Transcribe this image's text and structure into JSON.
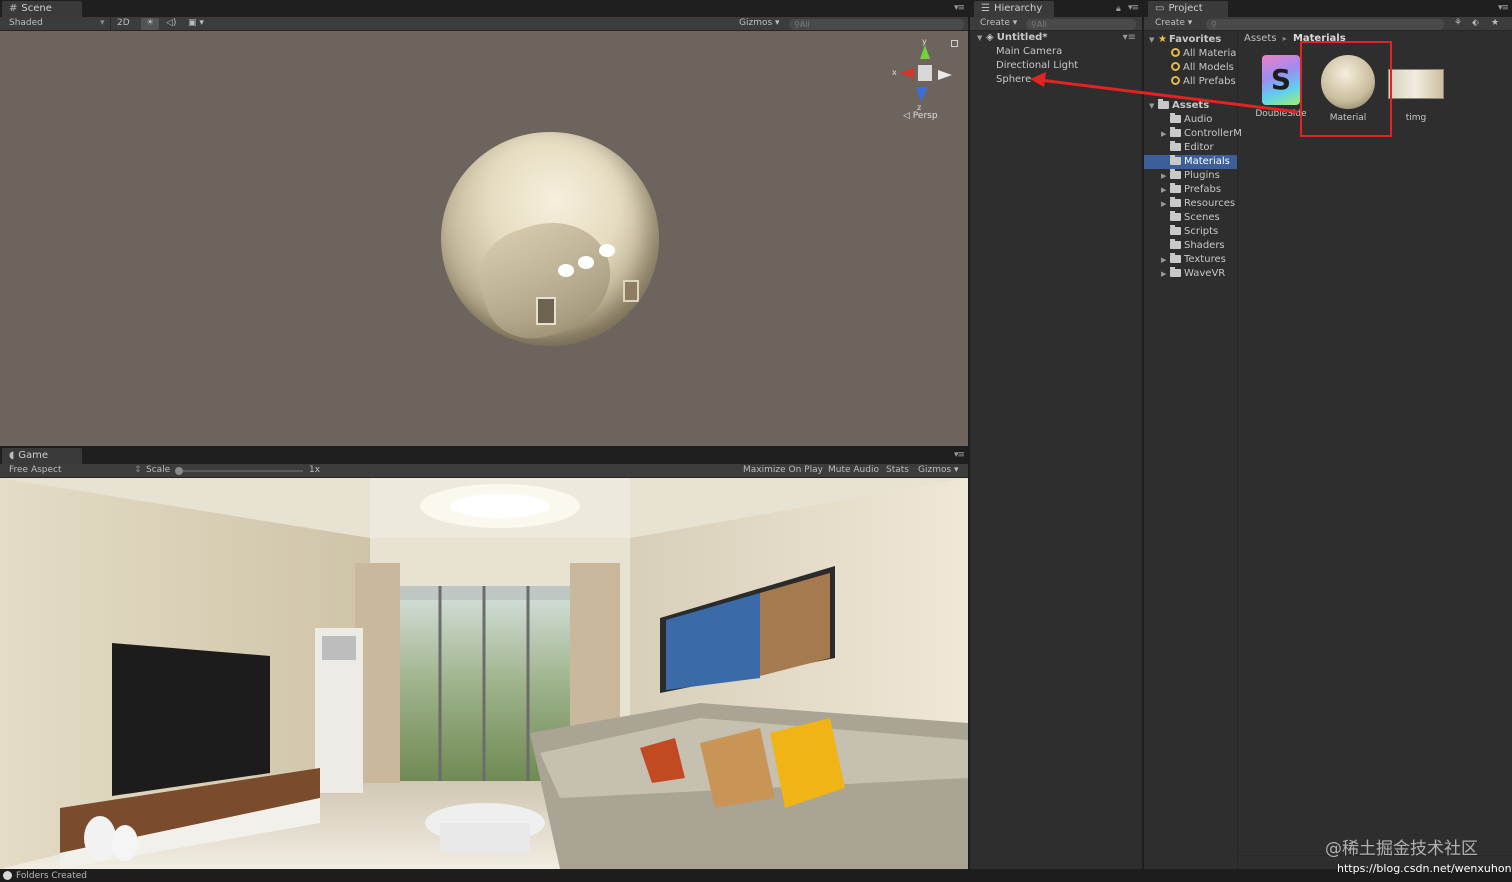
{
  "scene": {
    "tab": "Scene",
    "shading": "Shaded",
    "mode_2d": "2D",
    "gizmos": "Gizmos",
    "search_placeholder": "All",
    "projection": "Persp",
    "axis_x": "x",
    "axis_y": "y",
    "axis_z": "z"
  },
  "game": {
    "tab": "Game",
    "aspect": "Free Aspect",
    "scale_label": "Scale",
    "scale_value": "1x",
    "maximize": "Maximize On Play",
    "mute": "Mute Audio",
    "stats": "Stats",
    "gizmos": "Gizmos"
  },
  "hierarchy": {
    "tab": "Hierarchy",
    "create": "Create",
    "search_placeholder": "All",
    "scene_name": "Untitled*",
    "items": [
      "Main Camera",
      "Directional Light",
      "Sphere"
    ]
  },
  "project": {
    "tab": "Project",
    "create": "Create",
    "favorites": {
      "label": "Favorites",
      "items": [
        "All Materia",
        "All Models",
        "All Prefabs"
      ]
    },
    "assets": {
      "label": "Assets",
      "folders": [
        "Audio",
        "ControllerM",
        "Editor",
        "Materials",
        "Plugins",
        "Prefabs",
        "Resources",
        "Scenes",
        "Scripts",
        "Shaders",
        "Textures",
        "WaveVR"
      ],
      "selected": "Materials"
    },
    "breadcrumb": [
      "Assets",
      "Materials"
    ],
    "grid": [
      {
        "name": "DoubleSide",
        "icon": "shader-icon",
        "glyph": "S"
      },
      {
        "name": "Material",
        "icon": "material-sphere-icon"
      },
      {
        "name": "timg",
        "icon": "texture-thumbnail"
      }
    ]
  },
  "status": "Folders Created",
  "watermark": {
    "line1": "@稀土掘金技术社区",
    "line2": "https://blog.csdn.net/wenxuhonghe"
  },
  "colors": {
    "selection": "#3c5f99",
    "annotation": "#e32323",
    "scene_bg": "#6c645d"
  }
}
